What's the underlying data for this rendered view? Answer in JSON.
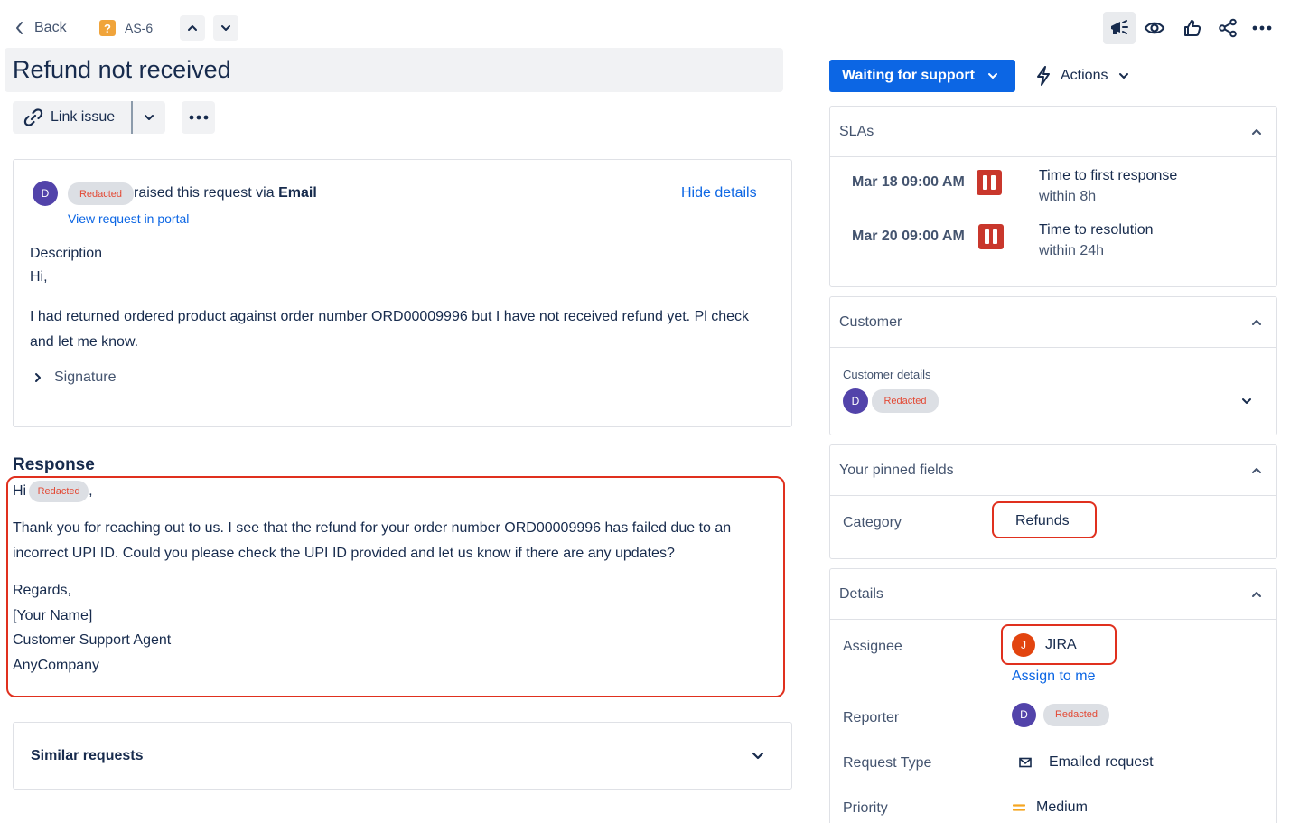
{
  "topbar": {
    "back_label": "Back",
    "issue_key": "AS-6"
  },
  "issue": {
    "title": "Refund not received",
    "link_issue_label": "Link issue"
  },
  "request": {
    "reporter_initial": "D",
    "reporter_name": "Redacted",
    "raised_text": "raised this request via",
    "channel": "Email",
    "hide_details": "Hide details",
    "view_portal": "View request in portal",
    "description_label": "Description",
    "greeting": "Hi,",
    "body": "I had returned ordered product against order number ORD00009996 but I have not received refund yet. Pl check and let me know.",
    "signature_label": "Signature"
  },
  "response": {
    "heading": "Response",
    "hi": "Hi",
    "name": "Redacted",
    "comma": ",",
    "para": "Thank you for reaching out to us. I see that the refund for your order number ORD00009996 has failed due to an incorrect UPI ID. Could you please check the UPI ID provided and let us know if there are any updates?",
    "regards": "Regards,",
    "your_name": "[Your Name]",
    "role": "Customer Support Agent",
    "company": "AnyCompany"
  },
  "similar": {
    "label": "Similar requests"
  },
  "status": {
    "label": "Waiting for support",
    "actions_label": "Actions",
    "color": "#0c66e4"
  },
  "slas": {
    "title": "SLAs",
    "items": [
      {
        "time": "Mar 18 09:00 AM",
        "name": "Time to first response",
        "target": "within 8h"
      },
      {
        "time": "Mar 20 09:00 AM",
        "name": "Time to resolution",
        "target": "within 24h"
      }
    ]
  },
  "customer": {
    "title": "Customer",
    "details_label": "Customer details",
    "initial": "D",
    "name": "Redacted"
  },
  "pinned": {
    "title": "Your pinned fields",
    "category_label": "Category",
    "category_value": "Refunds"
  },
  "details": {
    "title": "Details",
    "assignee_label": "Assignee",
    "assignee_initial": "J",
    "assignee_name": "JIRA",
    "assign_to_me": "Assign to me",
    "reporter_label": "Reporter",
    "reporter_initial": "D",
    "reporter_name": "Redacted",
    "request_type_label": "Request Type",
    "request_type_value": "Emailed request",
    "priority_label": "Priority",
    "priority_value": "Medium"
  }
}
